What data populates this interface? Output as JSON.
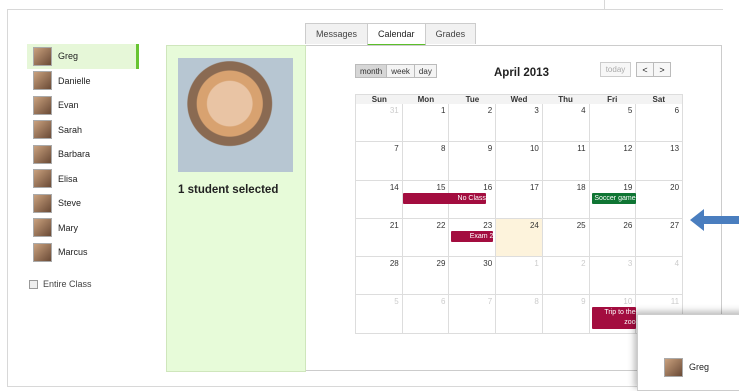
{
  "tabs": [
    "Messages",
    "Calendar",
    "Grades"
  ],
  "students": [
    "Greg",
    "Danielle",
    "Evan",
    "Sarah",
    "Barbara",
    "Elisa",
    "Steve",
    "Mary",
    "Marcus"
  ],
  "entire_class_label": "Entire Class",
  "selected_count_text": "1 student selected",
  "calendar": {
    "title": "April 2013",
    "views": [
      "month",
      "week",
      "day"
    ],
    "today_label": "today",
    "prev": "<",
    "next": ">",
    "weekdays": [
      "Sun",
      "Mon",
      "Tue",
      "Wed",
      "Thu",
      "Fri",
      "Sat"
    ],
    "weeks": [
      [
        "31",
        "1",
        "2",
        "3",
        "4",
        "5",
        "6"
      ],
      [
        "7",
        "8",
        "9",
        "10",
        "11",
        "12",
        "13"
      ],
      [
        "14",
        "15",
        "16",
        "17",
        "18",
        "19",
        "20"
      ],
      [
        "21",
        "22",
        "23",
        "24",
        "25",
        "26",
        "27"
      ],
      [
        "28",
        "29",
        "30",
        "1",
        "2",
        "3",
        "4"
      ],
      [
        "5",
        "6",
        "7",
        "8",
        "9",
        "10",
        "11"
      ]
    ],
    "events": {
      "no_class": "No Class",
      "soccer": "Soccer game",
      "exam": "Exam 2",
      "trip": "Trip to the zoo"
    }
  },
  "popup": {
    "student": "Greg"
  },
  "colors": {
    "accent": "#5cbf2a",
    "event_red": "#a30d3f",
    "event_green": "#0f7533",
    "arrow": "#4a7ebf"
  }
}
